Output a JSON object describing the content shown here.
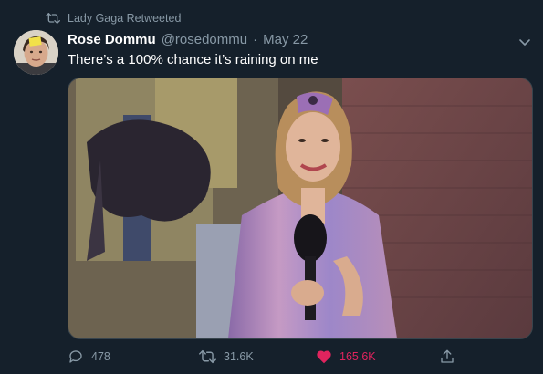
{
  "retweet_context": {
    "label": "Lady Gaga Retweeted",
    "icon": "retweet-icon"
  },
  "tweet": {
    "display_name": "Rose Dommu",
    "handle": "@rosedommu",
    "separator": "·",
    "date": "May 22",
    "text": "There’s a 100% chance it’s raining on me",
    "media": {
      "kind": "photo"
    }
  },
  "actions": {
    "reply_count": "478",
    "retweet_count": "31.6K",
    "like_count": "165.6K",
    "like_color": "#e0245e",
    "share_icon": "share-icon"
  },
  "colors": {
    "background": "#15202b",
    "muted": "#8899a6",
    "like": "#e0245e",
    "border": "#38444d"
  }
}
